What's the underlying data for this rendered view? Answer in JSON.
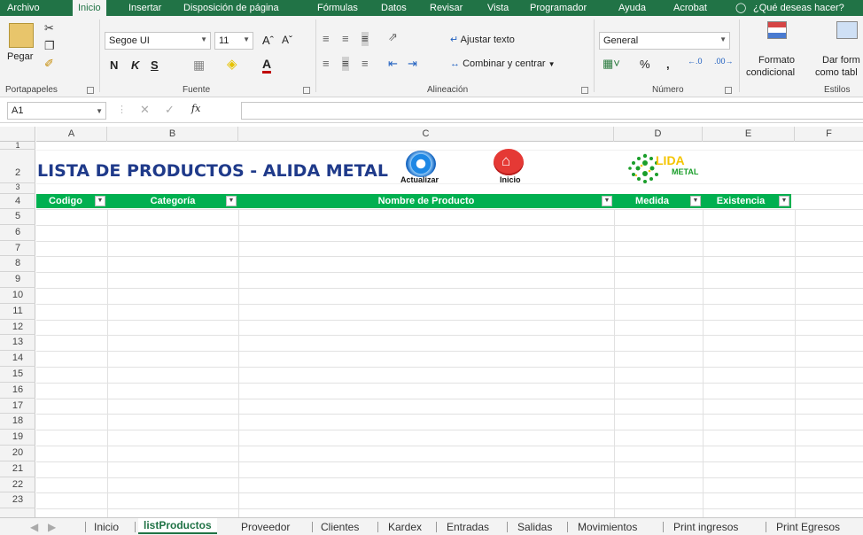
{
  "ribbon_tabs": [
    "Archivo",
    "Inicio",
    "Insertar",
    "Disposición de página",
    "Fórmulas",
    "Datos",
    "Revisar",
    "Vista",
    "Programador",
    "Ayuda",
    "Acrobat"
  ],
  "tell_me": "¿Qué deseas hacer?",
  "clipboard": {
    "paste": "Pegar",
    "group": "Portapapeles"
  },
  "font": {
    "name": "Segoe UI",
    "size": "11",
    "bold": "N",
    "italic": "K",
    "underline": "S",
    "group": "Fuente"
  },
  "alignment": {
    "wrap": "Ajustar texto",
    "merge": "Combinar y centrar",
    "group": "Alineación"
  },
  "number": {
    "format": "General",
    "percent": "%",
    "comma": ",",
    "group": "Número"
  },
  "styles": {
    "cond1": "Formato",
    "cond2": "condicional",
    "table1": "Dar form",
    "table2": "como tabl",
    "group": "Estilos"
  },
  "formula_bar": {
    "cell": "A1",
    "fx": "fx",
    "value": ""
  },
  "columns": [
    "A",
    "B",
    "C",
    "D",
    "E",
    "F"
  ],
  "rows": [
    "1",
    "2",
    "3",
    "4",
    "5",
    "6",
    "7",
    "8",
    "9",
    "10",
    "11",
    "12",
    "13",
    "14",
    "15",
    "16",
    "17",
    "18",
    "19",
    "20",
    "21",
    "22",
    "23"
  ],
  "sheet_title": "LISTA DE PRODUCTOS - ALIDA METAL",
  "buttons": {
    "refresh": "Actualizar",
    "home": "Inicio"
  },
  "logo": {
    "line1": "LIDA",
    "line2": "METAL"
  },
  "table_headers": [
    "Codigo",
    "Categoría",
    "Nombre de Producto",
    "Medida",
    "Existencia"
  ],
  "sheet_tabs": [
    "Inicio",
    "listProductos",
    "Proveedor",
    "Clientes",
    "Kardex",
    "Entradas",
    "Salidas",
    "Movimientos",
    "Print ingresos",
    "Print Egresos"
  ],
  "colors": {
    "excel_green": "#217346",
    "table_green": "#00b050",
    "title_blue": "#1f3a8a",
    "refresh_blue": "#1e88e5",
    "home_red": "#e53935"
  },
  "icons": [
    "cut-icon",
    "copy-icon",
    "format-painter-icon",
    "refresh-gear-icon",
    "home-icon",
    "filter-dropdown-icon"
  ]
}
